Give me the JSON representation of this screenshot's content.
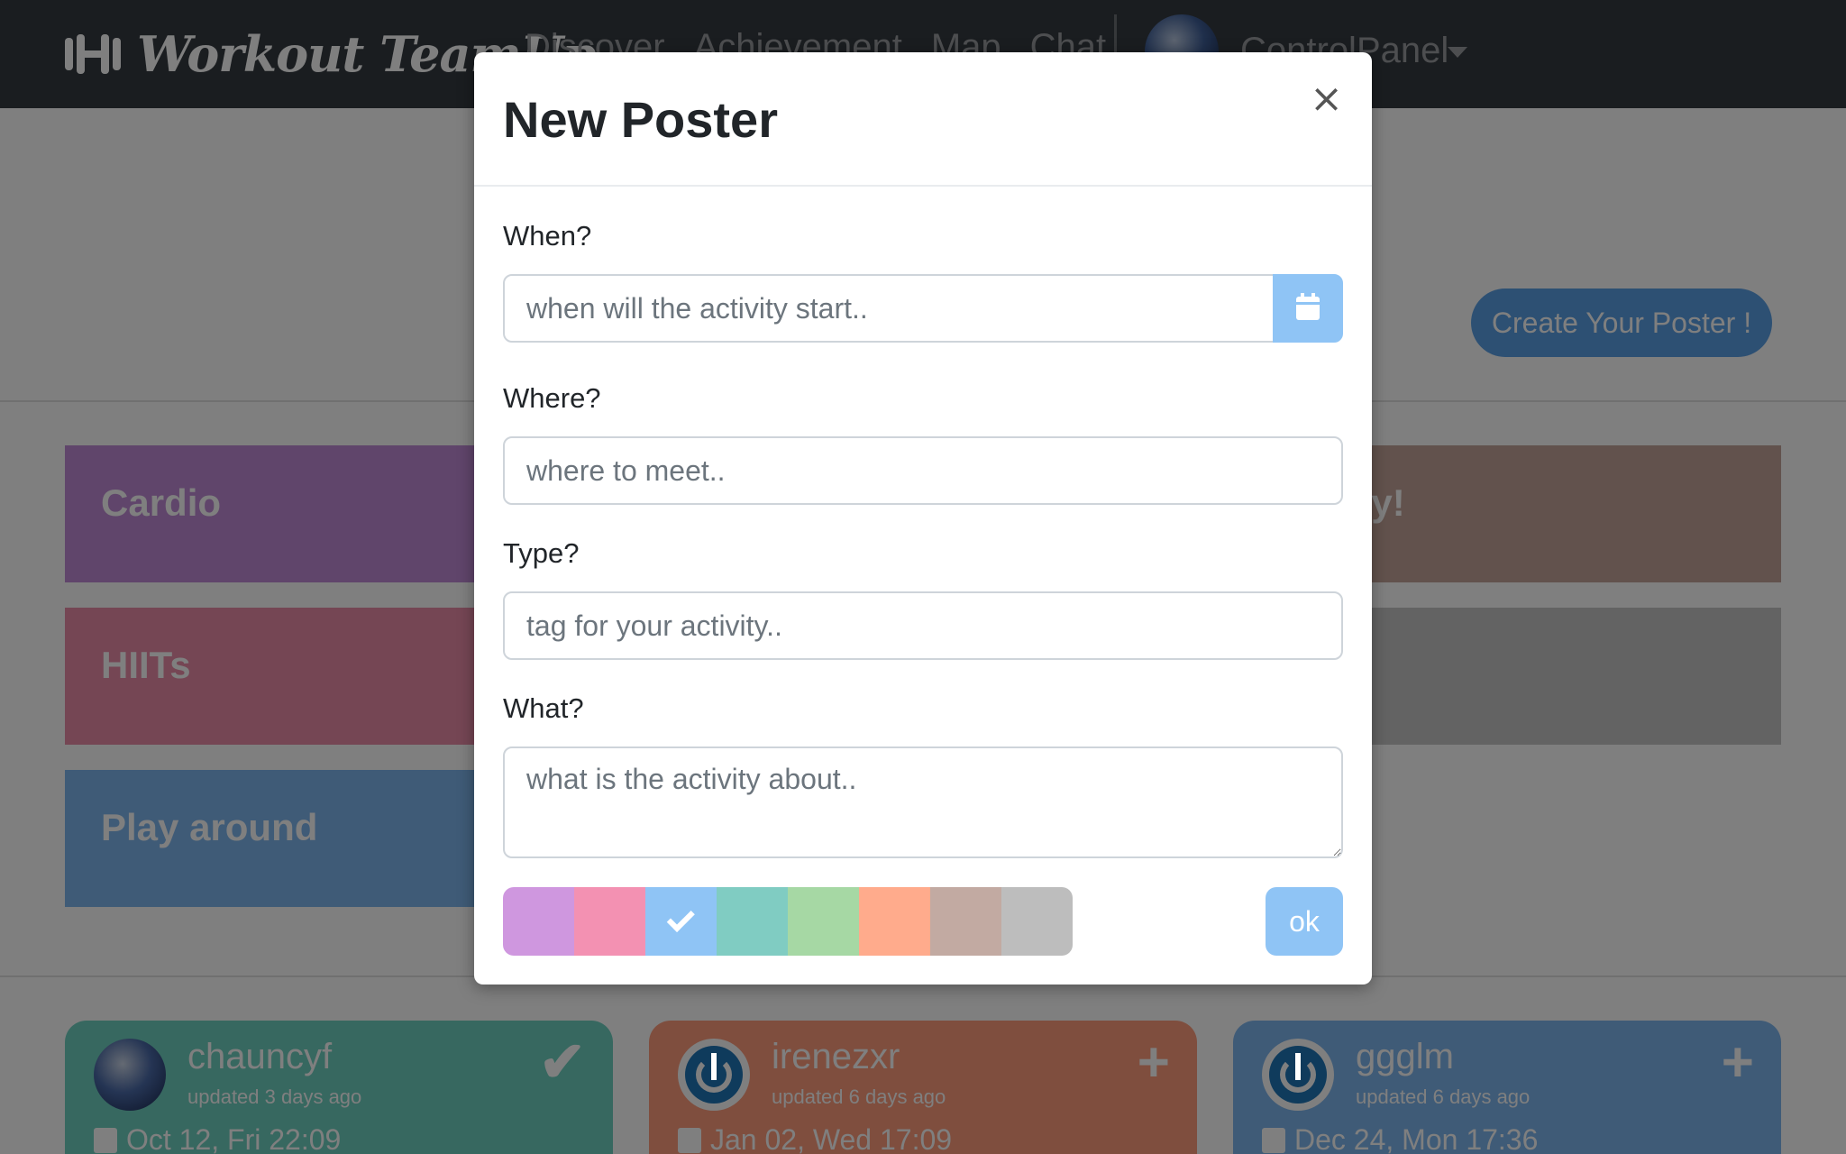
{
  "navbar": {
    "brand": "Workout TeamUp",
    "links": [
      "Discover",
      "Achievement",
      "Map",
      "Chat"
    ],
    "user": "ControlPanel"
  },
  "hero": {
    "create_button": "Create Your Poster !"
  },
  "categories": [
    {
      "label": "Cardio"
    },
    {
      "label": "HIITs"
    },
    {
      "label": "Play around"
    },
    {
      "label": "ay!"
    },
    {
      "label": ""
    }
  ],
  "posters": [
    {
      "username": "chauncyf",
      "updated": "updated 3 days ago",
      "date": "Oct 12, Fri 22:09",
      "action": "joined"
    },
    {
      "username": "irenezxr",
      "updated": "updated 6 days ago",
      "date": "Jan 02, Wed 17:09",
      "action": "join"
    },
    {
      "username": "ggglm",
      "updated": "updated 6 days ago",
      "date": "Dec 24, Mon 17:36",
      "action": "join"
    }
  ],
  "modal": {
    "title": "New Poster",
    "close": "×",
    "when": {
      "label": "When?",
      "placeholder": "when will the activity start.."
    },
    "where": {
      "label": "Where?",
      "placeholder": "where to meet.."
    },
    "type": {
      "label": "Type?",
      "placeholder": "tag for your activity.."
    },
    "what": {
      "label": "What?",
      "placeholder": "what is the activity about.."
    },
    "colors": [
      "#cf97df",
      "#f391b2",
      "#8fc4f5",
      "#80ccc2",
      "#a6d8a4",
      "#ffab8c",
      "#c2aaa2",
      "#bdbdbd"
    ],
    "selected_color_index": 2,
    "ok": "ok"
  }
}
